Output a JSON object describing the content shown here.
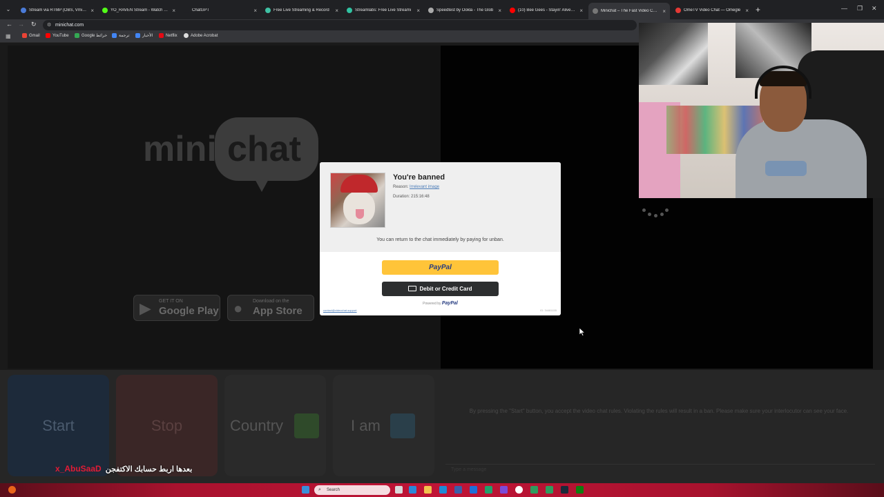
{
  "browser": {
    "tabs": [
      {
        "label": "Stream via RTMP (OBS, Vmix, Z",
        "color": "#4a7bd8"
      },
      {
        "label": "YO_RAVEN Stream - Watch Liv",
        "color": "#53fc18"
      },
      {
        "label": "ChatGPT",
        "color": "#202124"
      },
      {
        "label": "Free Live Streaming & Record",
        "color": "#3fc1a4"
      },
      {
        "label": "Streamlabs: Free Live Streami",
        "color": "#31c3a2"
      },
      {
        "label": "Speedtest by Ookla - The Glob",
        "color": "#aaaaaa"
      },
      {
        "label": "(10) Bee Gees - Stayin' Alive (O",
        "color": "#ff0000"
      },
      {
        "label": "Minichat – The Fast Video Chat",
        "color": "#777777"
      },
      {
        "label": "OmeTV Video Chat — Omegle",
        "color": "#e53935"
      }
    ],
    "active_tab_index": 7,
    "url": "minichat.com",
    "bookmarks": [
      {
        "label": "Gmail",
        "color": "#ea4335"
      },
      {
        "label": "YouTube",
        "color": "#ff0000"
      },
      {
        "label": "Google خرائط",
        "color": "#34a853"
      },
      {
        "label": "ترجمة",
        "color": "#4285f4"
      },
      {
        "label": "الأخبار",
        "color": "#4285f4"
      },
      {
        "label": "Netflix",
        "color": "#e50914"
      },
      {
        "label": "Adobe Acrobat",
        "color": "#dddddd"
      }
    ]
  },
  "page": {
    "logo_left": "mini",
    "logo_right": "chat",
    "google_play": {
      "small": "GET IT ON",
      "big": "Google Play"
    },
    "app_store": {
      "small": "Download on the",
      "big": "App Store"
    },
    "buttons": {
      "start": "Start",
      "stop": "Stop",
      "country": "Country",
      "iam": "I am"
    },
    "rules_text": "By pressing the \"Start\" button, you accept the video chat rules. Violating the rules will result in a ban. Please make sure your interlocutor can see your face.",
    "chat_placeholder": "Type a message"
  },
  "ban_modal": {
    "title": "You're banned",
    "reason_label": "Reason:",
    "reason_value": "Irrelevant image",
    "duration_label": "Duration:",
    "duration_value": "215:16:48",
    "message": "You can return to the chat immediately by paying for unban.",
    "paypal_label": "PayPal",
    "card_label": "Debit or Credit Card",
    "powered_by": "Powered by",
    "powered_brand": "PayPal",
    "contact": "contact@videochat.support",
    "id_text": "ID: 34481155"
  },
  "caption": {
    "username": "x_AbuSaaD",
    "text": "بعدها اربط حسابك الاكتفجن"
  },
  "taskbar": {
    "search_placeholder": "Search"
  }
}
